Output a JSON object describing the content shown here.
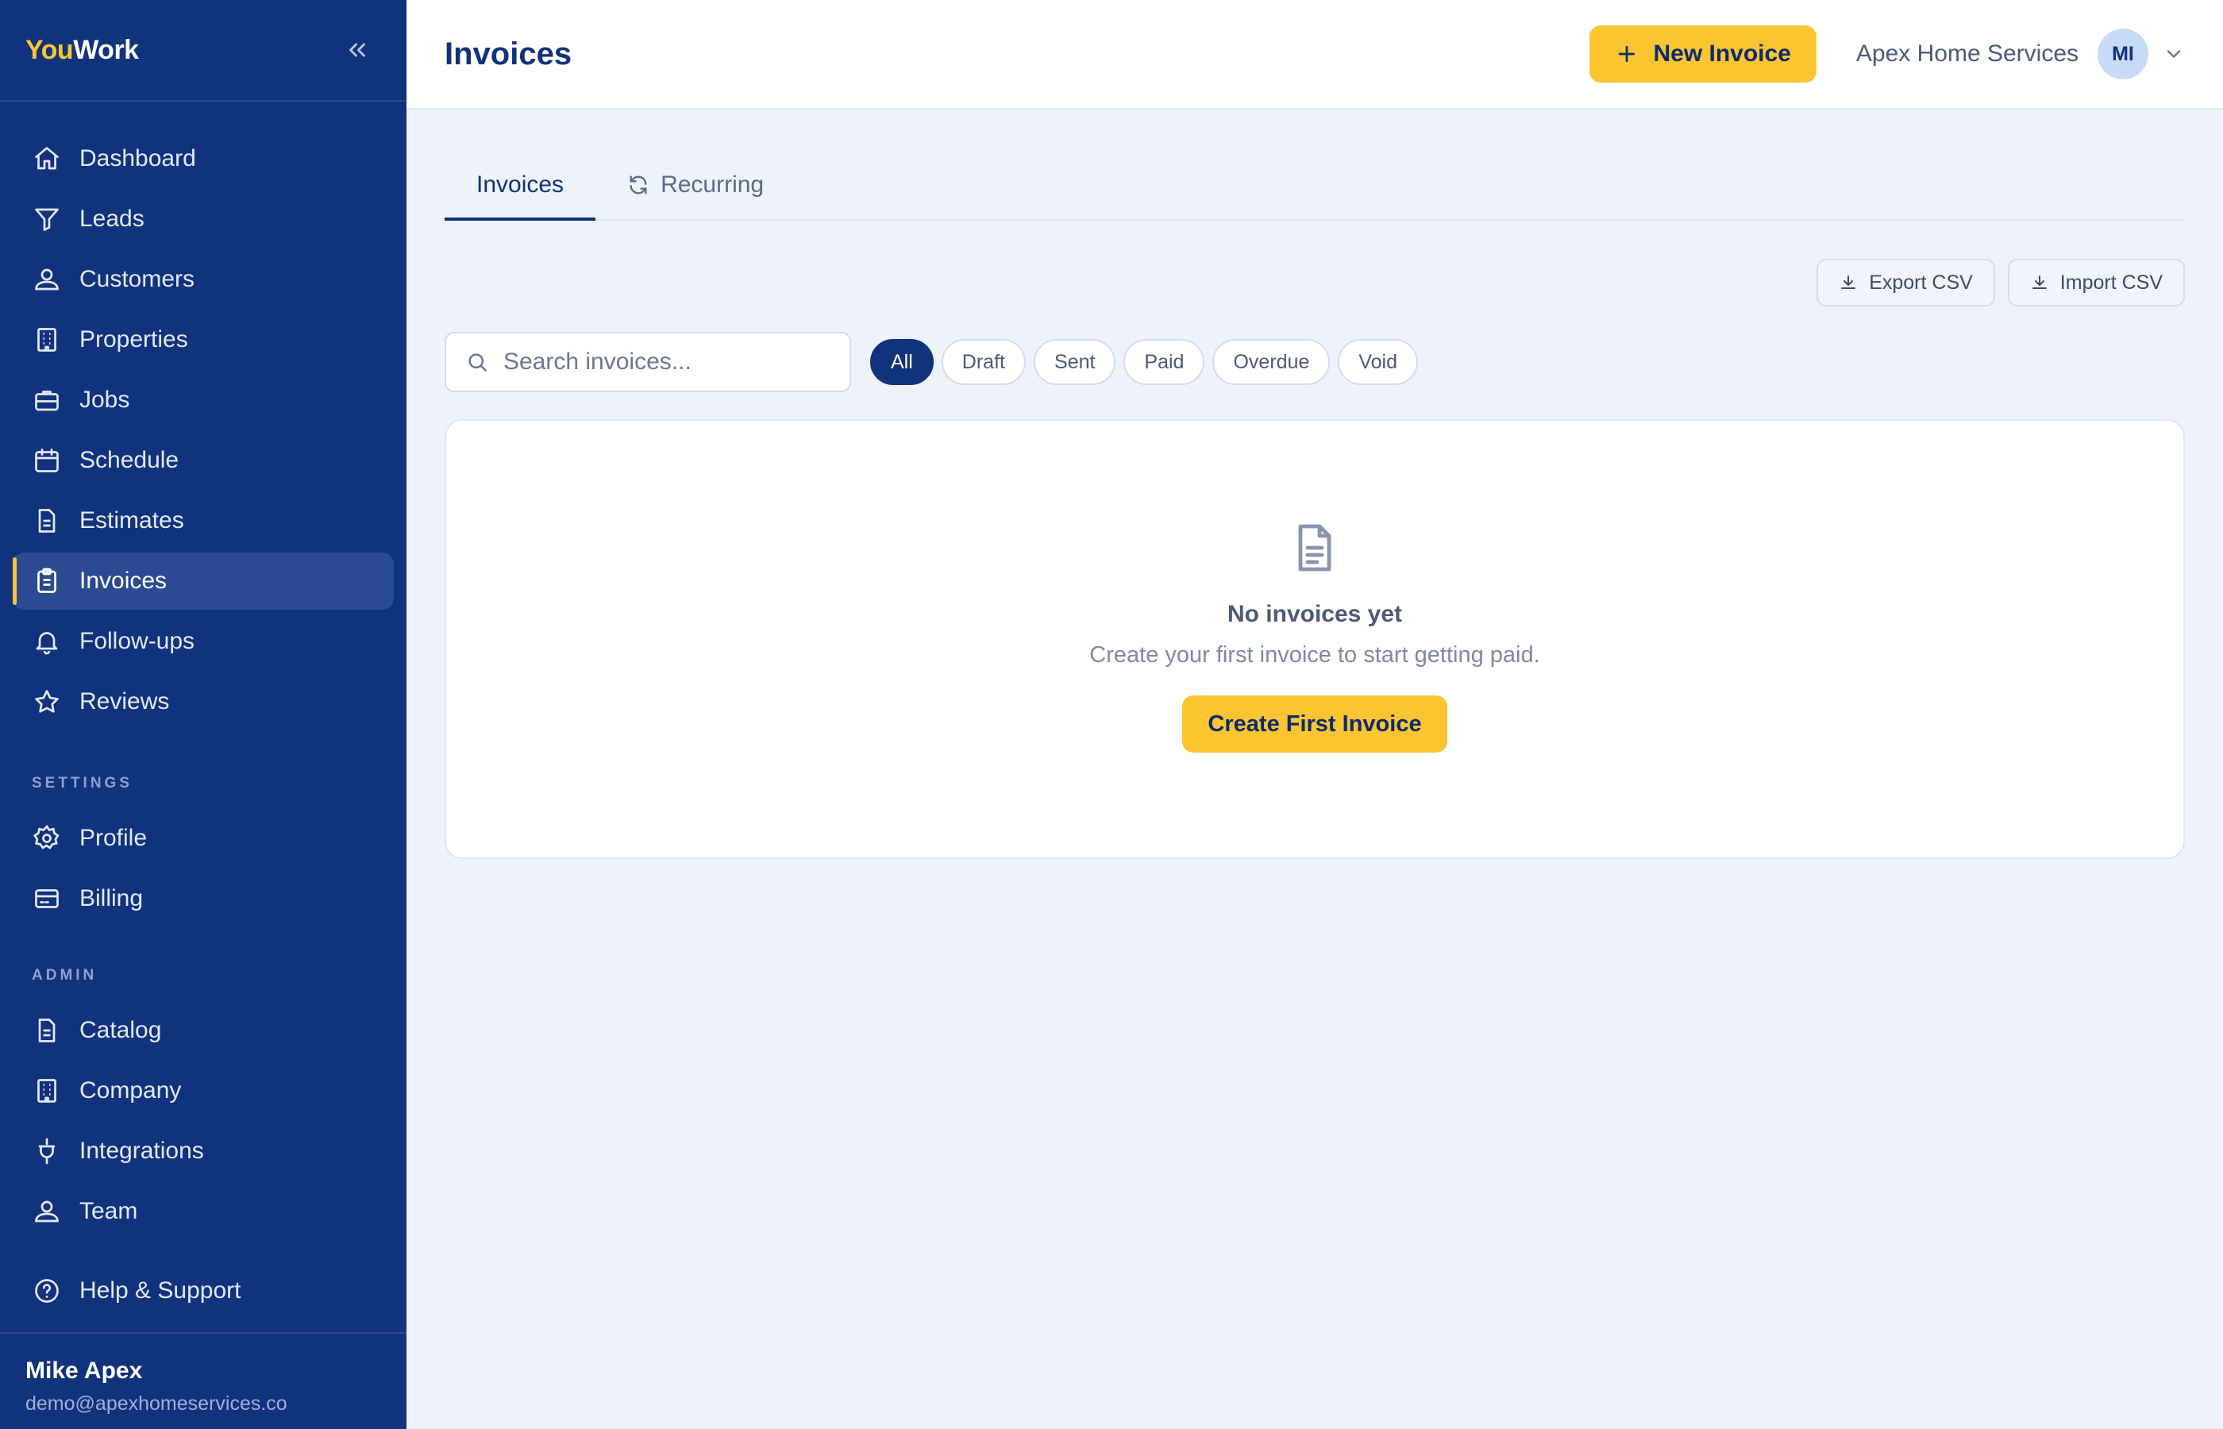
{
  "brand": {
    "part1": "You",
    "part2": "Work"
  },
  "sidebar": {
    "items": [
      {
        "label": "Dashboard"
      },
      {
        "label": "Leads"
      },
      {
        "label": "Customers"
      },
      {
        "label": "Properties"
      },
      {
        "label": "Jobs"
      },
      {
        "label": "Schedule"
      },
      {
        "label": "Estimates"
      },
      {
        "label": "Invoices",
        "active": true
      },
      {
        "label": "Follow-ups"
      },
      {
        "label": "Reviews"
      }
    ],
    "settings_label": "SETTINGS",
    "settings_items": [
      {
        "label": "Profile"
      },
      {
        "label": "Billing"
      }
    ],
    "admin_label": "ADMIN",
    "admin_items": [
      {
        "label": "Catalog"
      },
      {
        "label": "Company"
      },
      {
        "label": "Integrations"
      },
      {
        "label": "Team"
      }
    ],
    "help": {
      "label": "Help & Support"
    },
    "user": {
      "name": "Mike Apex",
      "email": "demo@apexhomeservices.co"
    }
  },
  "header": {
    "title": "Invoices",
    "new_button": "New Invoice",
    "company": "Apex Home Services",
    "avatar_initials": "MI"
  },
  "tabs": [
    {
      "label": "Invoices",
      "active": true
    },
    {
      "label": "Recurring"
    }
  ],
  "toolbar": {
    "export_label": "Export CSV",
    "import_label": "Import CSV"
  },
  "search": {
    "placeholder": "Search invoices...",
    "value": ""
  },
  "filters": [
    {
      "label": "All",
      "active": true
    },
    {
      "label": "Draft"
    },
    {
      "label": "Sent"
    },
    {
      "label": "Paid"
    },
    {
      "label": "Overdue"
    },
    {
      "label": "Void"
    }
  ],
  "empty_state": {
    "title": "No invoices yet",
    "subtitle": "Create your first invoice to start getting paid.",
    "button": "Create First Invoice"
  },
  "colors": {
    "sidebar": "#11327c",
    "accent": "#fbc531",
    "background": "#eef3fb"
  }
}
